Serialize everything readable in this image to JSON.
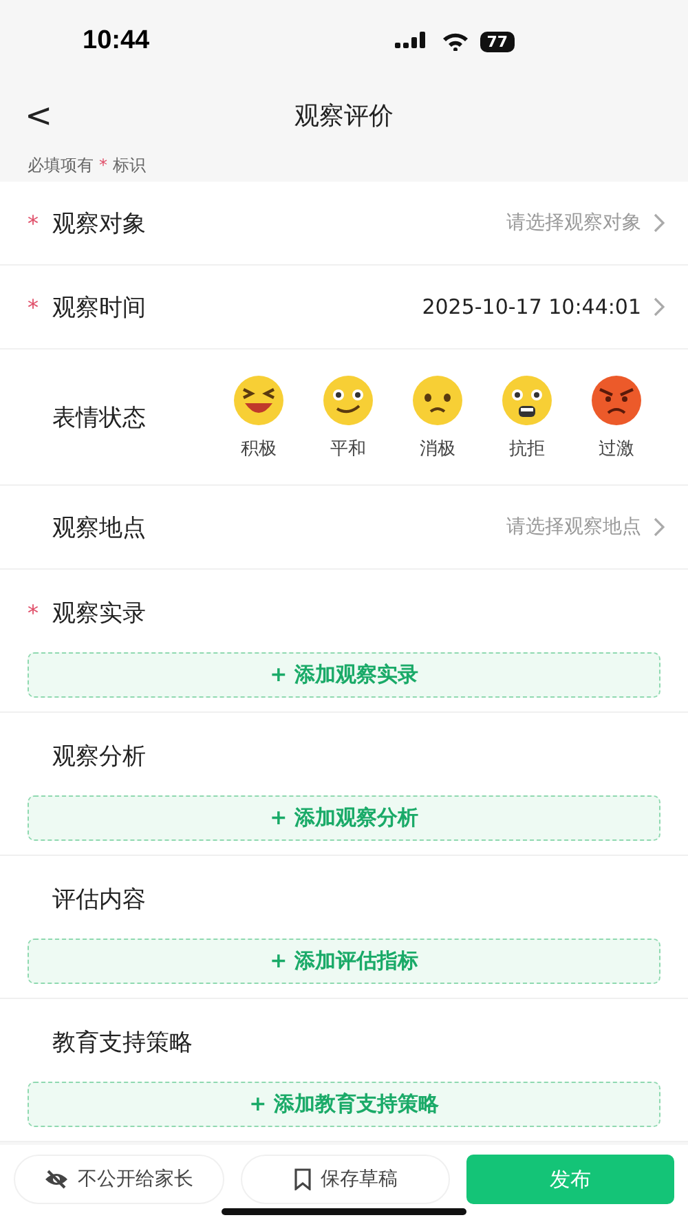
{
  "status_bar": {
    "time": "10:44",
    "battery": "77"
  },
  "header": {
    "back": "<",
    "title": "观察评价"
  },
  "required_note": {
    "text": "必填项有",
    "mark": "*",
    "suffix": "标识"
  },
  "fields": [
    {
      "kind": "select",
      "required": true,
      "label": "观察对象",
      "placeholder": "请选择观察对象"
    },
    {
      "kind": "select",
      "required": true,
      "label": "观察时间",
      "value": "2025-10-17 10:44:01"
    },
    {
      "kind": "moods",
      "required": false,
      "label": "表情状态",
      "moods": [
        {
          "kind": "laugh",
          "label": "积极"
        },
        {
          "kind": "calm",
          "label": "平和"
        },
        {
          "kind": "sad",
          "label": "消极"
        },
        {
          "kind": "shock",
          "label": "抗拒"
        },
        {
          "kind": "angry",
          "label": "过激"
        }
      ]
    },
    {
      "kind": "select",
      "required": false,
      "label": "观察地点",
      "placeholder": "请选择观察地点"
    },
    {
      "kind": "section",
      "required": true,
      "label": "观察实录",
      "button": "+ 添加观察实录"
    },
    {
      "kind": "section",
      "required": false,
      "label": "观察分析",
      "button": "+ 添加观察分析"
    },
    {
      "kind": "section",
      "required": false,
      "label": "评估内容",
      "button": "+ 添加评估指标"
    },
    {
      "kind": "section",
      "required": false,
      "label": "教育支持策略",
      "button": "+ 添加教育支持策略"
    }
  ],
  "bottom_bar": [
    {
      "kind": "private",
      "label": "不公开给家长"
    },
    {
      "kind": "draft",
      "label": "保存草稿"
    },
    {
      "kind": "publish",
      "label": "发布"
    }
  ]
}
